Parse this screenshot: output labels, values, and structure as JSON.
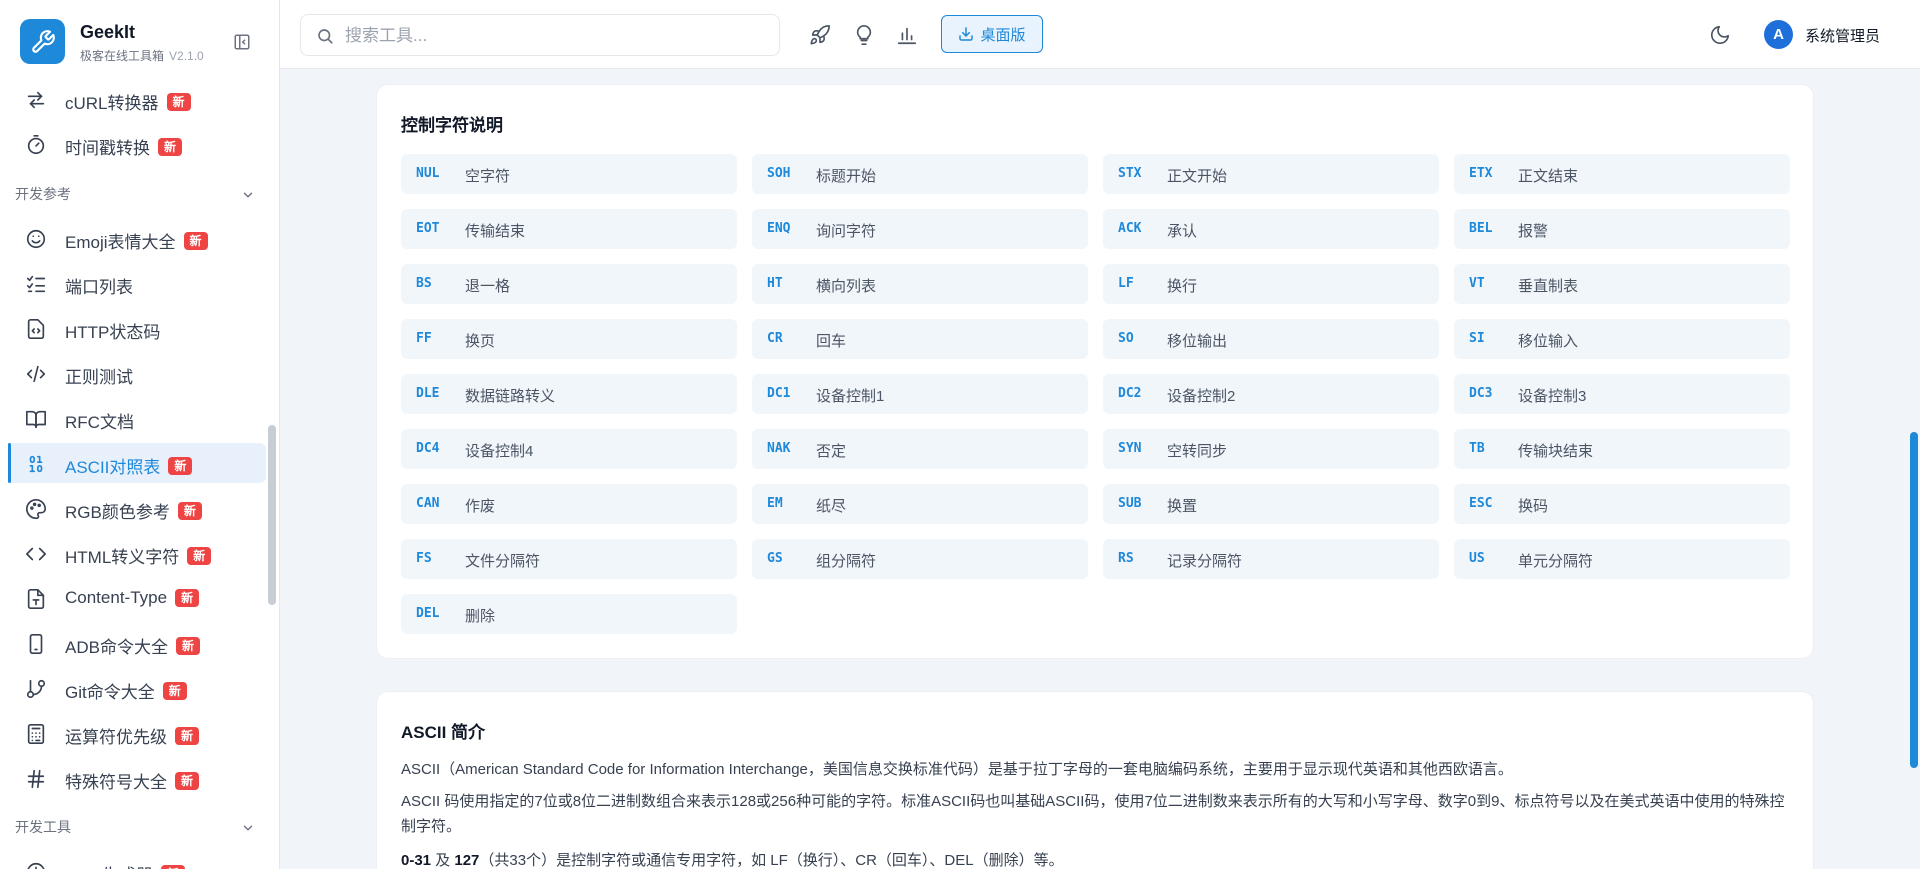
{
  "brand": {
    "name": "GeekIt",
    "subtitle": "极客在线工具箱",
    "version": "V2.1.0"
  },
  "sidebar": {
    "items_top": [
      {
        "label": "cURL转换器",
        "badge": "新",
        "icon": "arrows-swap-icon"
      },
      {
        "label": "时间戳转换",
        "badge": "新",
        "icon": "timer-icon"
      }
    ],
    "group_dev_ref": "开发参考",
    "items_ref": [
      {
        "label": "Emoji表情大全",
        "badge": "新",
        "icon": "smile-icon"
      },
      {
        "label": "端口列表",
        "badge": "",
        "icon": "list-check-icon"
      },
      {
        "label": "HTTP状态码",
        "badge": "",
        "icon": "file-code-icon"
      },
      {
        "label": "正则测试",
        "badge": "",
        "icon": "code-slash-icon"
      },
      {
        "label": "RFC文档",
        "badge": "",
        "icon": "book-icon"
      },
      {
        "label": "ASCII对照表",
        "badge": "新",
        "icon": "binary-icon",
        "active": true
      },
      {
        "label": "RGB颜色参考",
        "badge": "新",
        "icon": "palette-icon"
      },
      {
        "label": "HTML转义字符",
        "badge": "新",
        "icon": "code-brackets-icon"
      },
      {
        "label": "Content-Type",
        "badge": "新",
        "icon": "file-type-icon"
      },
      {
        "label": "ADB命令大全",
        "badge": "新",
        "icon": "phone-icon"
      },
      {
        "label": "Git命令大全",
        "badge": "新",
        "icon": "git-branch-icon"
      },
      {
        "label": "运算符优先级",
        "badge": "新",
        "icon": "calculator-icon"
      },
      {
        "label": "特殊符号大全",
        "badge": "新",
        "icon": "hash-icon"
      }
    ],
    "group_dev_tools": "开发工具",
    "partial_item": {
      "label": "Cron生成器",
      "badge": "新"
    }
  },
  "topbar": {
    "search_placeholder": "搜索工具...",
    "desktop_label": "桌面版",
    "avatar_letter": "A",
    "user_name": "系统管理员"
  },
  "control_chars": {
    "title": "控制字符说明",
    "items": [
      {
        "code": "NUL",
        "desc": "空字符"
      },
      {
        "code": "SOH",
        "desc": "标题开始"
      },
      {
        "code": "STX",
        "desc": "正文开始"
      },
      {
        "code": "ETX",
        "desc": "正文结束"
      },
      {
        "code": "EOT",
        "desc": "传输结束"
      },
      {
        "code": "ENQ",
        "desc": "询问字符"
      },
      {
        "code": "ACK",
        "desc": "承认"
      },
      {
        "code": "BEL",
        "desc": "报警"
      },
      {
        "code": "BS",
        "desc": "退一格"
      },
      {
        "code": "HT",
        "desc": "横向列表"
      },
      {
        "code": "LF",
        "desc": "换行"
      },
      {
        "code": "VT",
        "desc": "垂直制表"
      },
      {
        "code": "FF",
        "desc": "换页"
      },
      {
        "code": "CR",
        "desc": "回车"
      },
      {
        "code": "SO",
        "desc": "移位输出"
      },
      {
        "code": "SI",
        "desc": "移位输入"
      },
      {
        "code": "DLE",
        "desc": "数据链路转义"
      },
      {
        "code": "DC1",
        "desc": "设备控制1"
      },
      {
        "code": "DC2",
        "desc": "设备控制2"
      },
      {
        "code": "DC3",
        "desc": "设备控制3"
      },
      {
        "code": "DC4",
        "desc": "设备控制4"
      },
      {
        "code": "NAK",
        "desc": "否定"
      },
      {
        "code": "SYN",
        "desc": "空转同步"
      },
      {
        "code": "TB",
        "desc": "传输块结束"
      },
      {
        "code": "CAN",
        "desc": "作废"
      },
      {
        "code": "EM",
        "desc": "纸尽"
      },
      {
        "code": "SUB",
        "desc": "换置"
      },
      {
        "code": "ESC",
        "desc": "换码"
      },
      {
        "code": "FS",
        "desc": "文件分隔符"
      },
      {
        "code": "GS",
        "desc": "组分隔符"
      },
      {
        "code": "RS",
        "desc": "记录分隔符"
      },
      {
        "code": "US",
        "desc": "单元分隔符"
      },
      {
        "code": "DEL",
        "desc": "删除"
      }
    ]
  },
  "ascii_intro": {
    "title": "ASCII 简介",
    "p1": "ASCII（American Standard Code for Information Interchange，美国信息交换标准代码）是基于拉丁字母的一套电脑编码系统，主要用于显示现代英语和其他西欧语言。",
    "p2": "ASCII 码使用指定的7位或8位二进制数组合来表示128或256种可能的字符。标准ASCII码也叫基础ASCII码，使用7位二进制数来表示所有的大写和小写字母、数字0到9、标点符号以及在美式英语中使用的特殊控制字符。",
    "p3_b1": "0-31",
    "p3_mid": " 及 ",
    "p3_b2": "127",
    "p3_rest": "（共33个）是控制字符或通信专用字符，如 LF（换行）、CR（回车）、DEL（删除）等。"
  },
  "colors": {
    "accent": "#1e88d9",
    "badge": "#ef4444",
    "cell_bg": "#f1f6fb"
  }
}
